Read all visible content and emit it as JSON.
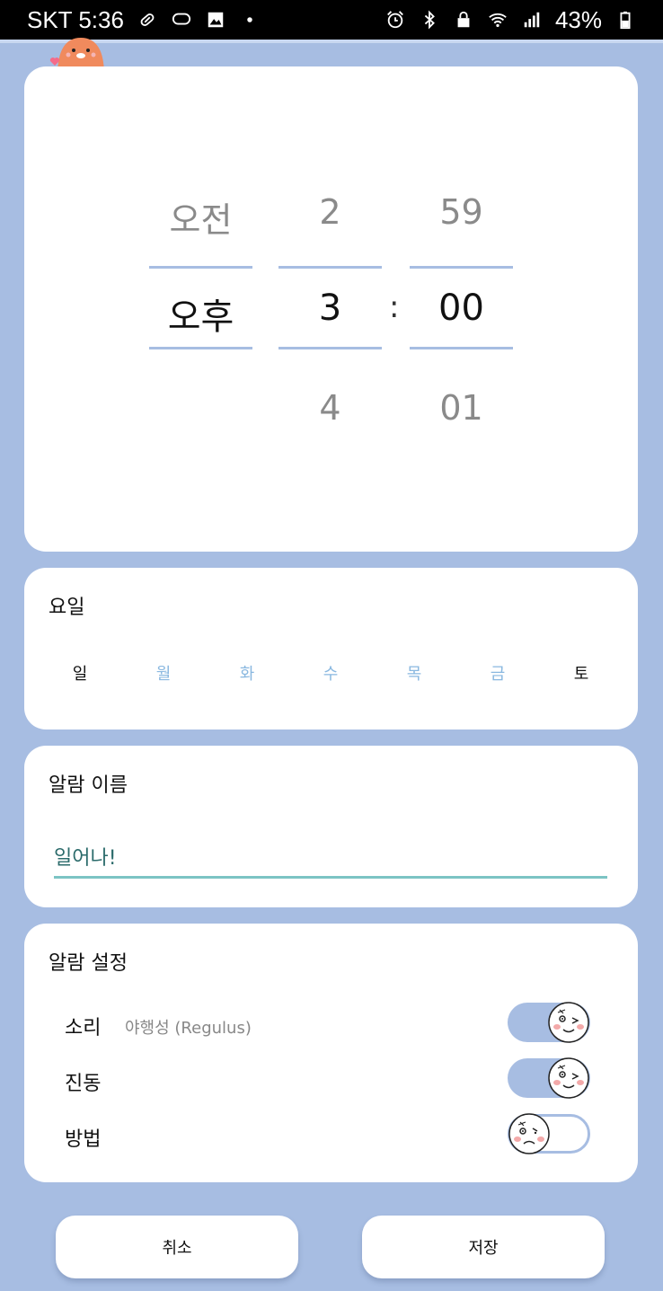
{
  "status_bar": {
    "carrier_time": "SKT 5:36",
    "battery": "43%",
    "icons_left": [
      "pill-icon",
      "chat-icon",
      "image-icon",
      "dot-icon"
    ],
    "icons_right": [
      "alarm-icon",
      "bluetooth-icon",
      "lock-icon",
      "wifi-icon",
      "signal-icon",
      "battery-icon"
    ]
  },
  "picker": {
    "ampm": {
      "prev": "오전",
      "current": "오후",
      "next": ""
    },
    "hour": {
      "prev": "2",
      "current": "3",
      "next": "4"
    },
    "separator": ":",
    "minute": {
      "prev": "59",
      "current": "00",
      "next": "01"
    }
  },
  "days": {
    "title": "요일",
    "items": [
      {
        "label": "일",
        "selected": false
      },
      {
        "label": "월",
        "selected": true
      },
      {
        "label": "화",
        "selected": true
      },
      {
        "label": "수",
        "selected": true
      },
      {
        "label": "목",
        "selected": true
      },
      {
        "label": "금",
        "selected": true
      },
      {
        "label": "토",
        "selected": false
      }
    ]
  },
  "alarm_name": {
    "title": "알람 이름",
    "value": "일어나!"
  },
  "settings": {
    "title": "알람 설정",
    "sound": {
      "label": "소리",
      "value": "야행성 (Regulus)",
      "on": true
    },
    "vibration": {
      "label": "진동",
      "on": true
    },
    "method": {
      "label": "방법",
      "on": false
    }
  },
  "buttons": {
    "cancel": "취소",
    "save": "저장"
  },
  "colors": {
    "background": "#a7bde2",
    "accent_line": "#7cc4c4",
    "day_selected": "#8ab8e0"
  }
}
